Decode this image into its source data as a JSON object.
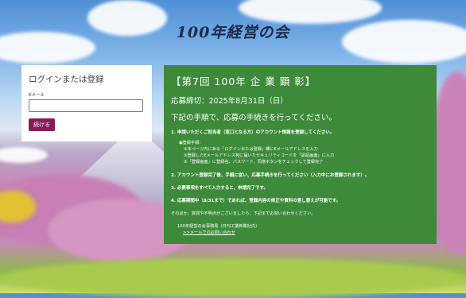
{
  "site": {
    "title": "100年経営の会"
  },
  "login": {
    "title": "ログインまたは登録",
    "email_label": "Eメール",
    "email_value": "",
    "email_placeholder": "",
    "continue_label": "続ける"
  },
  "info": {
    "title": "【第7回 100年 企 業 顕 彰】",
    "deadline": "応募締切：2025年8月31日（日）",
    "intro": "下記の手順で、応募の手続きを行ってください。",
    "step1": "1. 申請いただくご担当者（窓口となる方）のアカウント情報を登録してください。",
    "registration": {
      "heading": "●登録手順：",
      "items": [
        "①本ページ内にある「ログインまたは登録」欄にEメールアドレスを入力",
        "②登録したEメールアドレス宛に届いたセキュリティコードを「認証画面」に入力",
        "③「登録画面」に登録名、パスワード、同意ボタンをチェックして登録完了"
      ]
    },
    "step2": "2. アカウント登録完了後、手順に従い、応募手続きを行ってください（入力中にお登録されます）。",
    "step3": "3. 必要事項をすべて入力すると、申請完了です。",
    "step4": "4. 応募期間中（8/31まで）であれば、登録内容の修正や資料の差し替えが可能です。",
    "contact_note": "そのほか、質問や不明点がございましたら、下記までお問い合わせください。",
    "office": "100年経営の会事務局（日刊工業新聞社内）",
    "contact_link": ">>メールでのお問い合わせ"
  },
  "colors": {
    "panel_green": "#3d8b3a",
    "button_maroon": "#8a1b5a"
  }
}
